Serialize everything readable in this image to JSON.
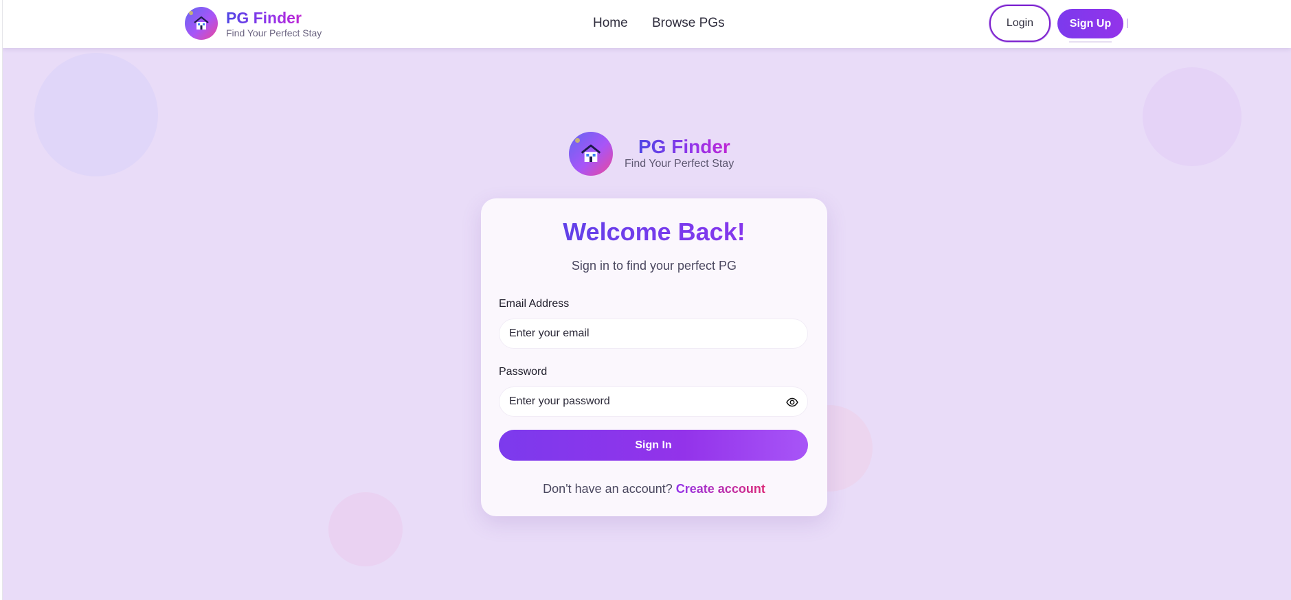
{
  "brand": {
    "title": "PG Finder",
    "tagline": "Find Your Perfect Stay",
    "logo_icon": "house-icon"
  },
  "nav": {
    "links": [
      {
        "label": "Home"
      },
      {
        "label": "Browse PGs"
      }
    ],
    "login_label": "Login",
    "signup_label": "Sign Up"
  },
  "login_card": {
    "title": "Welcome Back!",
    "subtitle": "Sign in to find your perfect PG",
    "email": {
      "label": "Email Address",
      "placeholder": "Enter your email",
      "value": ""
    },
    "password": {
      "label": "Password",
      "placeholder": "Enter your password",
      "value": "",
      "toggle_icon": "eye-icon"
    },
    "submit_label": "Sign In",
    "footer_text": "Don't have an account?",
    "footer_link": "Create account"
  },
  "colors": {
    "accent": "#7c3aed",
    "accent_pink": "#db2777",
    "background": "#e9dcf8"
  }
}
